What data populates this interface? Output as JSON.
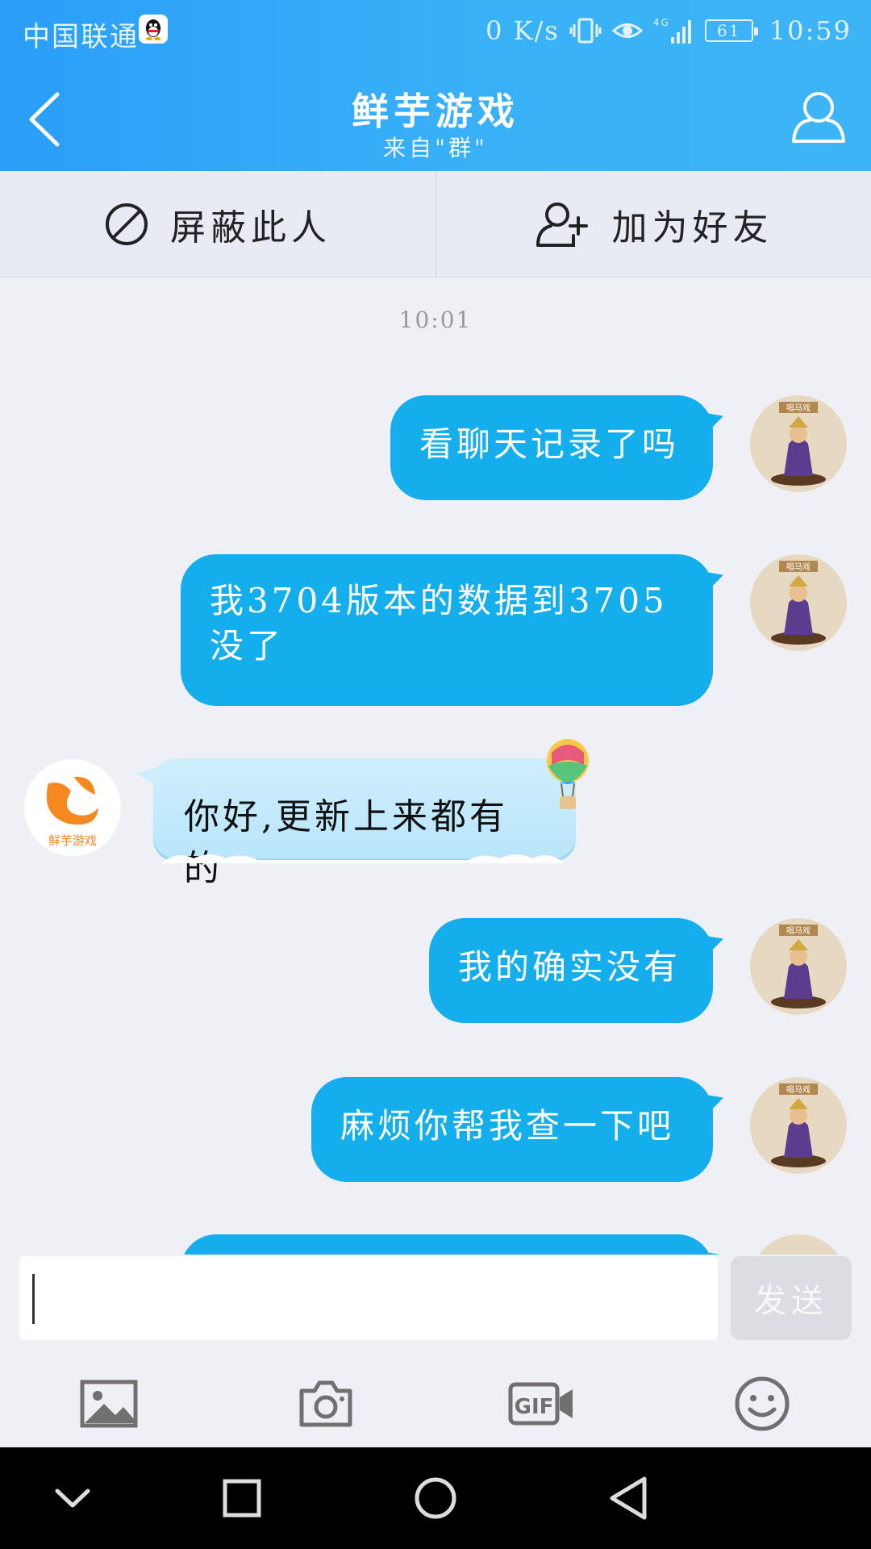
{
  "statusbar": {
    "carrier": "中国联通",
    "speed": "0 K/s",
    "network": "4G",
    "battery": "61",
    "time": "10:59"
  },
  "header": {
    "title": "鲜芋游戏",
    "subtitle": "来自\"群\""
  },
  "actions": {
    "block_label": "屏蔽此人",
    "add_friend_label": "加为好友"
  },
  "chat": {
    "timestamp": "10:01",
    "messages": [
      {
        "from": "me",
        "text": "看聊天记录了吗"
      },
      {
        "from": "me",
        "text": "我3704版本的数据到3705没了"
      },
      {
        "from": "them",
        "text": "你好,更新上来都有的"
      },
      {
        "from": "me",
        "text": "我的确实没有"
      },
      {
        "from": "me",
        "text": "麻烦你帮我查一下吧"
      }
    ],
    "them_avatar_text": "鲜芋游戏",
    "me_avatar_text": "唱马戏"
  },
  "input": {
    "value": "",
    "send_label": "发送"
  },
  "toolbar": {
    "icons": [
      "image-icon",
      "camera-icon",
      "gif-icon",
      "emoji-icon"
    ]
  },
  "colors": {
    "header_start": "#2a9ef8",
    "header_end": "#3cb4f6",
    "bubble_out": "#15aeed",
    "bubble_in": "#cfeefc",
    "brand_orange": "#f5891f"
  }
}
